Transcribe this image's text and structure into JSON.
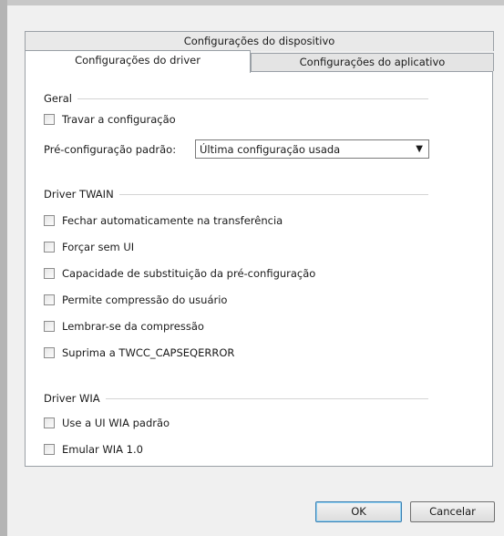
{
  "tabs": {
    "device_settings": "Configurações do dispositivo",
    "driver_settings": "Configurações do driver",
    "app_settings": "Configurações do aplicativo"
  },
  "general": {
    "title": "Geral",
    "lock_config": "Travar a configuração",
    "default_preset_label": "Pré-configuração padrão:",
    "default_preset_value": "Última configuração usada"
  },
  "twain": {
    "title": "Driver TWAIN",
    "options": [
      "Fechar automaticamente na transferência",
      "Forçar sem UI",
      "Capacidade de substituição da pré-configuração",
      "Permite compressão do usuário",
      "Lembrar-se da compressão",
      "Suprima a TWCC_CAPSEQERROR"
    ]
  },
  "wia": {
    "title": "Driver WIA",
    "options": [
      "Use a UI WIA padrão",
      "Emular WIA 1.0"
    ]
  },
  "buttons": {
    "ok": "OK",
    "cancel": "Cancelar"
  }
}
